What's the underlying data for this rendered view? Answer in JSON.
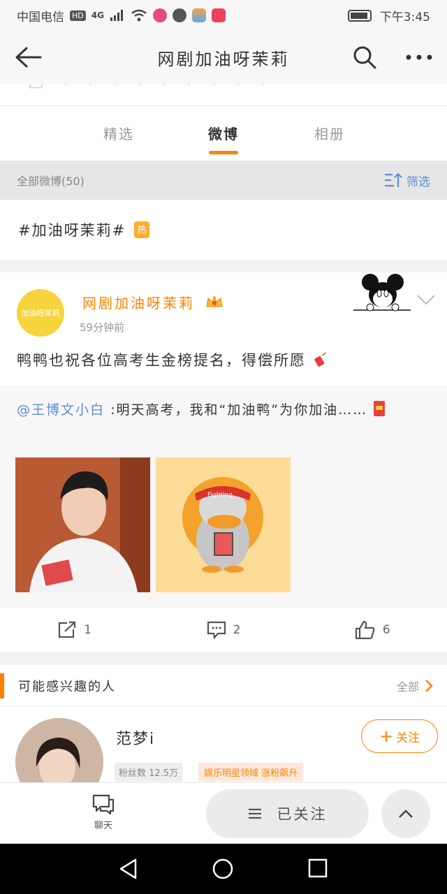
{
  "status_bar": {
    "carrier": "中国电信",
    "network_hd": "HD",
    "network_type": "4G",
    "time": "下午3:45"
  },
  "header": {
    "title": "网剧加油呀茉莉"
  },
  "tabs": [
    {
      "label": "精选",
      "active": false
    },
    {
      "label": "微博",
      "active": true
    },
    {
      "label": "相册",
      "active": false
    }
  ],
  "filter_bar": {
    "count_label": "全部微博(50)",
    "filter_label": "筛选"
  },
  "topic": {
    "text": "#加油呀茉莉#",
    "badge": "热"
  },
  "post": {
    "author": "网剧加油呀茉莉",
    "avatar_text": "加油呀茉莉",
    "time": "59分钟前",
    "text": "鸭鸭也祝各位高考生金榜提名，得偿所愿",
    "repost": {
      "mention": "@王博文小白",
      "text": ":明天高考，我和“加油鸭”为你加油……"
    },
    "photo2_caption": "Fighting",
    "actions": {
      "share_count": "1",
      "comment_count": "2",
      "like_count": "6"
    }
  },
  "suggestions": {
    "title": "可能感兴趣的人",
    "all_label": "全部",
    "person": {
      "name": "范梦i",
      "fans": "粉丝数 12.5万",
      "tag": "娱乐明星领域 涨粉飙升",
      "follow_label": "关注"
    }
  },
  "bottom_bar": {
    "chat_label": "聊天",
    "followed_label": "已关注"
  },
  "colors": {
    "accent": "#ff8200",
    "link": "#5b8fd9"
  }
}
